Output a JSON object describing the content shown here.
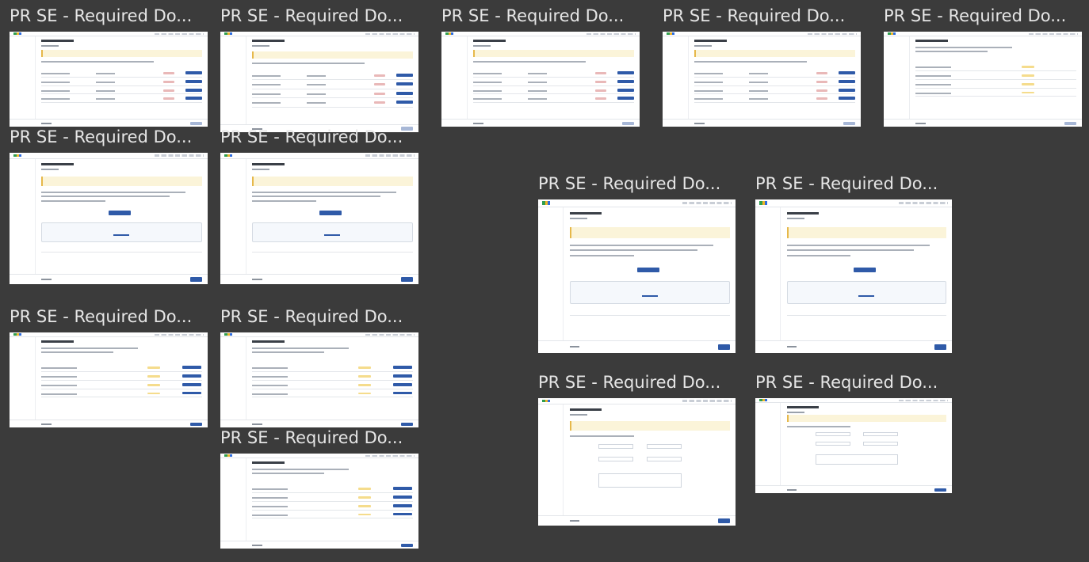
{
  "canvas": {
    "background": "#3b3b3b"
  },
  "frames": [
    {
      "id": "f1",
      "title": "PR SE - Required Do..."
    },
    {
      "id": "f2",
      "title": "PR SE - Required Do..."
    },
    {
      "id": "f3",
      "title": "PR SE - Required Do..."
    },
    {
      "id": "f4",
      "title": "PR SE - Required Do..."
    },
    {
      "id": "f5",
      "title": "PR SE - Required Do..."
    },
    {
      "id": "f6",
      "title": "PR SE - Required Do..."
    },
    {
      "id": "f7",
      "title": "PR SE - Required Do..."
    },
    {
      "id": "f8",
      "title": "PR SE - Required Do..."
    },
    {
      "id": "f9",
      "title": "PR SE - Required Do..."
    },
    {
      "id": "f10",
      "title": "PR SE - Required Do..."
    },
    {
      "id": "f11",
      "title": "PR SE - Required Do..."
    },
    {
      "id": "f12",
      "title": "PR SE - Required Do..."
    },
    {
      "id": "f13",
      "title": "PR SE - Required Do..."
    },
    {
      "id": "f14",
      "title": "PR SE - Required Do..."
    }
  ],
  "colors": {
    "title_text": "#e6e6e6",
    "thumb_bg": "#ffffff",
    "primary_button": "#2f5aa8",
    "warning_banner": "#fbf4d9",
    "status_red": "#e9b8b8",
    "status_yellow": "#f5dc8c"
  }
}
